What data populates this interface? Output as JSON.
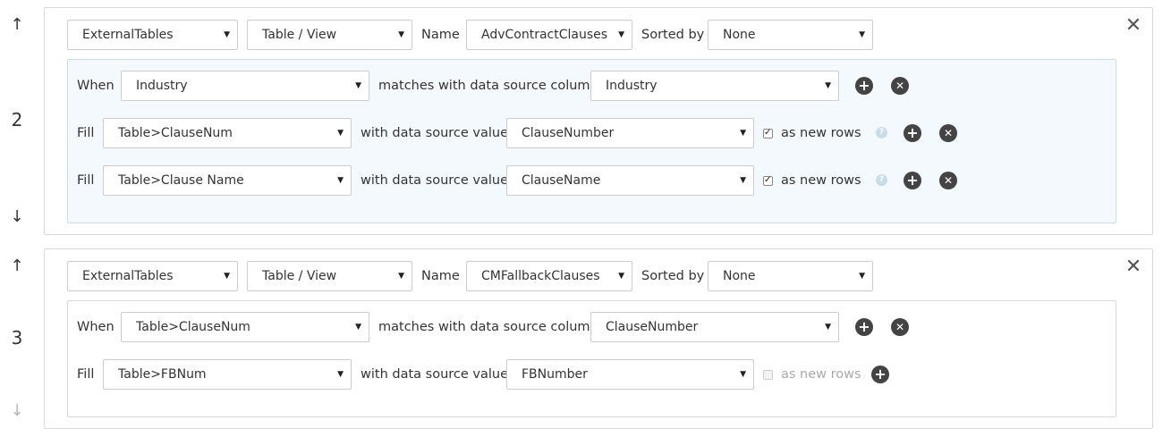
{
  "rules": [
    {
      "index": "2",
      "source": "ExternalTables",
      "object_type": "Table / View",
      "name_label": "Name",
      "name_value": "AdvContractClauses",
      "sorted_by_label": "Sorted by",
      "sorted_by_value": "None",
      "when": {
        "label": "When",
        "field": "Industry",
        "matches_label": "matches with data source column",
        "column": "Industry"
      },
      "fills": [
        {
          "label": "Fill",
          "field": "Table>ClauseNum",
          "with_label": "with data source value",
          "value": "ClauseNumber",
          "as_new_rows_label": "as new rows",
          "as_new_rows_checked": true
        },
        {
          "label": "Fill",
          "field": "Table>Clause Name",
          "with_label": "with data source value",
          "value": "ClauseName",
          "as_new_rows_label": "as new rows",
          "as_new_rows_checked": true
        }
      ]
    },
    {
      "index": "3",
      "source": "ExternalTables",
      "object_type": "Table / View",
      "name_label": "Name",
      "name_value": "CMFallbackClauses",
      "sorted_by_label": "Sorted by",
      "sorted_by_value": "None",
      "when": {
        "label": "When",
        "field": "Table>ClauseNum",
        "matches_label": "matches with data source column",
        "column": "ClauseNumber"
      },
      "fills": [
        {
          "label": "Fill",
          "field": "Table>FBNum",
          "with_label": "with data source value",
          "value": "FBNumber",
          "as_new_rows_label": "as new rows",
          "as_new_rows_checked": false
        }
      ]
    }
  ],
  "icons": {
    "up": "arrow-up-icon",
    "down": "arrow-down-icon",
    "close": "close-icon",
    "add": "plus-circle-icon",
    "remove": "x-circle-icon",
    "help": "help-icon"
  },
  "colors": {
    "inner_highlight": "#f4f9fd",
    "icon_dark": "#444444",
    "help": "#c8dde9"
  }
}
